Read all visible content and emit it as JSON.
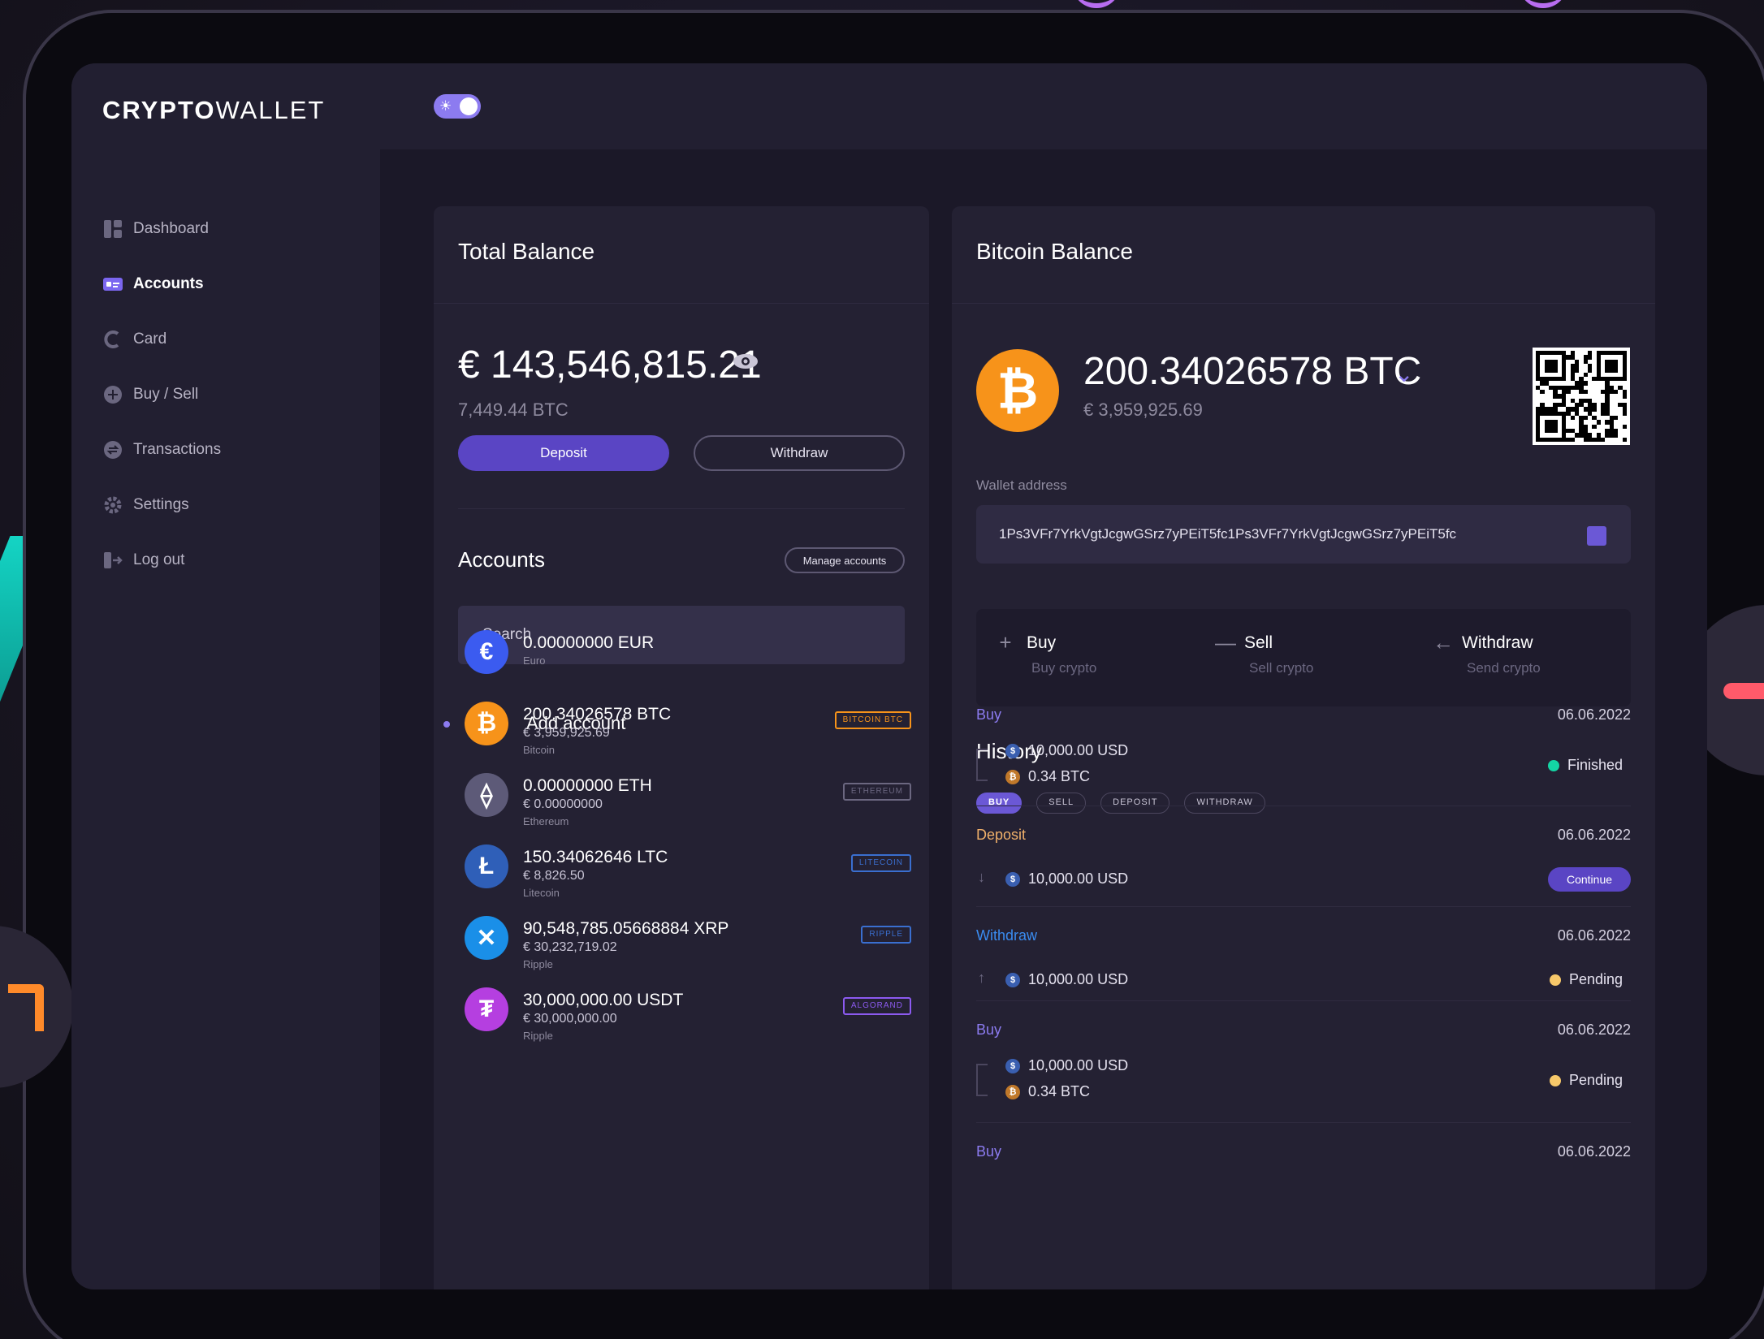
{
  "app": {
    "logo_bold": "CRYPTO",
    "logo_light": "WALLET"
  },
  "sidebar": {
    "items": [
      {
        "label": "Dashboard",
        "icon": "dashboard-icon"
      },
      {
        "label": "Accounts",
        "icon": "accounts-icon"
      },
      {
        "label": "Card",
        "icon": "card-icon"
      },
      {
        "label": "Buy / Sell",
        "icon": "buy-sell-icon"
      },
      {
        "label": "Transactions",
        "icon": "transactions-icon"
      },
      {
        "label": "Settings",
        "icon": "gear-icon"
      },
      {
        "label": "Log out",
        "icon": "logout-icon"
      }
    ],
    "active_index": 1
  },
  "total_balance": {
    "title": "Total Balance",
    "amount": "€ 143,546,815.21",
    "btc": "7,449.44 BTC",
    "deposit_label": "Deposit",
    "withdraw_label": "Withdraw"
  },
  "accounts": {
    "title": "Accounts",
    "manage_label": "Manage accounts",
    "search_placeholder": "Search",
    "add_label": "Add account",
    "items": [
      {
        "amount": "0.00000000 EUR",
        "value": "",
        "name": "Euro",
        "tag": "",
        "symbol": "€",
        "color": "#3b5bf0",
        "tag_color": ""
      },
      {
        "amount": "200.34026578 BTC",
        "value": "€ 3,959,925.69",
        "name": "Bitcoin",
        "tag": "BITCOIN BTC",
        "symbol": "₿",
        "color": "#f7931a",
        "tag_color": "#f7931a",
        "selected": true
      },
      {
        "amount": "0.00000000 ETH",
        "value": "€ 0.00000000",
        "name": "Ethereum",
        "tag": "ETHEREUM",
        "symbol": "⟠",
        "color": "#5d5a78",
        "tag_color": "#6b6780"
      },
      {
        "amount": "150.34062646 LTC",
        "value": "€ 8,826.50",
        "name": "Litecoin",
        "tag": "LITECOIN",
        "symbol": "Ł",
        "color": "#2f5fb8",
        "tag_color": "#3a6fd0"
      },
      {
        "amount": "90,548,785.05668884 XRP",
        "value": "€ 30,232,719.02",
        "name": "Ripple",
        "tag": "RIPPLE",
        "symbol": "✕",
        "color": "#1a8fe8",
        "tag_color": "#3a6fd0"
      },
      {
        "amount": "30,000,000.00 USDT",
        "value": "€ 30,000,000.00",
        "name": "Ripple",
        "tag": "ALGORAND",
        "symbol": "₮",
        "color": "#b53fe0",
        "tag_color": "#8c5af0"
      }
    ]
  },
  "bitcoin_balance": {
    "title": "Bitcoin Balance",
    "amount": "200.34026578 BTC",
    "eur": "€ 3,959,925.69",
    "wallet_label": "Wallet address",
    "wallet_address": "1Ps3VFr7YrkVgtJcgwGSrz7yPEiT5fc1Ps3VFr7YrkVgtJcgwGSrz7yPEiT5fc",
    "actions": [
      {
        "title": "Buy",
        "sub": "Buy crypto",
        "symbol": "+"
      },
      {
        "title": "Sell",
        "sub": "Sell crypto",
        "symbol": "—"
      },
      {
        "title": "Withdraw",
        "sub": "Send crypto",
        "symbol": "←"
      }
    ]
  },
  "history": {
    "title": "History",
    "filters": [
      "BUY",
      "SELL",
      "DEPOSIT",
      "WITHDRAW"
    ],
    "active_filter": 0,
    "entries": [
      {
        "type": "Buy",
        "type_color": "#8c7bf0",
        "date": "06.06.2022",
        "lines": [
          "10,000.00 USD",
          "0.34 BTC"
        ],
        "status": "Finished",
        "status_color": "#14d4a4"
      },
      {
        "type": "Deposit",
        "type_color": "#f0b06a",
        "date": "06.06.2022",
        "lines": [
          "10,000.00 USD"
        ],
        "action": "Continue"
      },
      {
        "type": "Withdraw",
        "type_color": "#3a8cf0",
        "date": "06.06.2022",
        "lines": [
          "10,000.00 USD"
        ],
        "status": "Pending",
        "status_color": "#f7c86a"
      },
      {
        "type": "Buy",
        "type_color": "#8c7bf0",
        "date": "06.06.2022",
        "lines": [
          "10,000.00 USD",
          "0.34 BTC"
        ],
        "status": "Pending",
        "status_color": "#f7c86a"
      },
      {
        "type": "Buy",
        "type_color": "#8c7bf0",
        "date": "06.06.2022",
        "lines": []
      }
    ]
  }
}
